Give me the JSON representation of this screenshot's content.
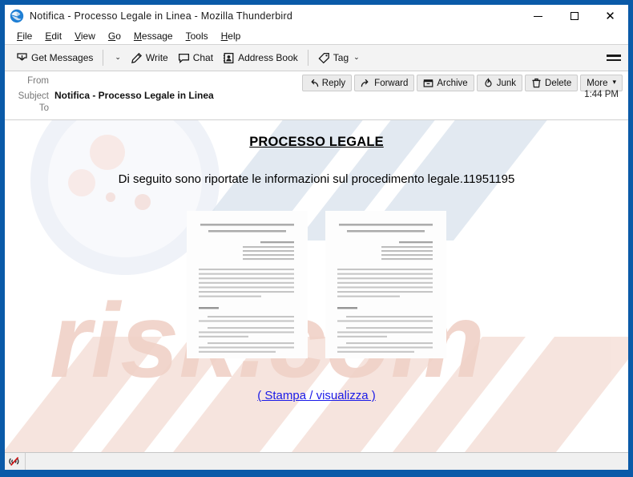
{
  "window": {
    "title": "Notifica - Processo Legale in Linea - Mozilla Thunderbird",
    "app_icon": "thunderbird-icon",
    "minimize_label": "—",
    "maximize_label": "",
    "close_label": "✕",
    "frame_color": "#0a5aa8"
  },
  "menubar": {
    "items": [
      {
        "label": "File",
        "accel": "F"
      },
      {
        "label": "Edit",
        "accel": "E"
      },
      {
        "label": "View",
        "accel": "V"
      },
      {
        "label": "Go",
        "accel": "G"
      },
      {
        "label": "Message",
        "accel": "M"
      },
      {
        "label": "Tools",
        "accel": "T"
      },
      {
        "label": "Help",
        "accel": "H"
      }
    ]
  },
  "toolbar": {
    "get_messages": "Get Messages",
    "get_messages_dropdown": "⌄",
    "write": "Write",
    "chat": "Chat",
    "address_book": "Address Book",
    "tag": "Tag",
    "tag_dropdown": "⌄",
    "app_menu": "☰"
  },
  "message_actions": [
    {
      "label": "Reply",
      "icon": "reply-arrow-icon"
    },
    {
      "label": "Forward",
      "icon": "forward-arrow-icon"
    },
    {
      "label": "Archive",
      "icon": "archive-box-icon"
    },
    {
      "label": "Junk",
      "icon": "junk-flame-icon"
    },
    {
      "label": "Delete",
      "icon": "trash-can-icon"
    },
    {
      "label": "More",
      "icon": "chevron-down-icon"
    }
  ],
  "message_header": {
    "from_label": "From",
    "from_value": "",
    "subject_label": "Subject",
    "subject_value": "Notifica - Processo Legale in Linea",
    "to_label": "To",
    "to_value": "",
    "time": "1:44 PM"
  },
  "message_body": {
    "title": "PROCESSO LEGALE",
    "paragraph": "Di seguito sono riportate le informazioni sul procedimento legale.11951195",
    "attachment_preview_count": 2,
    "link_text": "( Stampa / visualizza )",
    "link_color": "#1a1ae8",
    "watermark_text": "pcrisk.com"
  },
  "statusbar": {
    "offline_icon": "network-offline-icon",
    "text": ""
  }
}
